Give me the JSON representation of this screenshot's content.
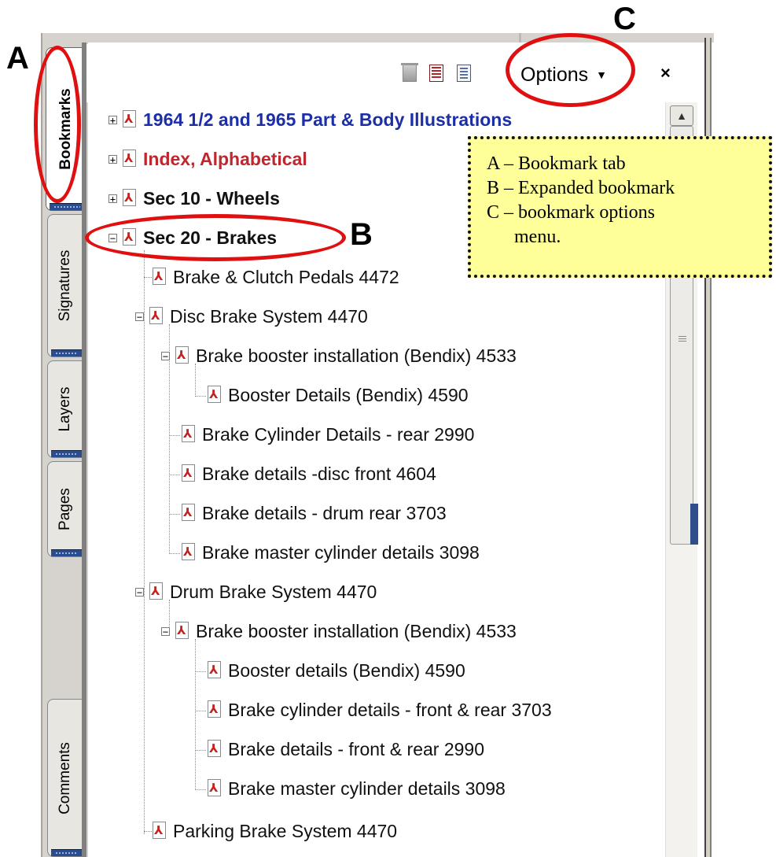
{
  "tabs": [
    {
      "label": "Bookmarks",
      "active": true
    },
    {
      "label": "Signatures",
      "active": false
    },
    {
      "label": "Layers",
      "active": false
    },
    {
      "label": "Pages",
      "active": false
    },
    {
      "label": "Comments",
      "active": false
    }
  ],
  "toolbar": {
    "delete_icon": "trash-icon",
    "new_bookmark_icon": "new-bookmark-icon",
    "expand_icon": "expand-bookmark-icon",
    "options_label": "Options",
    "close_glyph": "×"
  },
  "tree": [
    {
      "label": "1964 1/2 and 1965 Part & Body Illustrations",
      "style": "blue",
      "toggle": "+"
    },
    {
      "label": "Index, Alphabetical",
      "style": "red",
      "toggle": "+"
    },
    {
      "label": "Sec 10 - Wheels",
      "style": "bold",
      "toggle": "+"
    },
    {
      "label": "Sec 20 - Brakes",
      "style": "bold",
      "toggle": "−"
    },
    {
      "label": "Brake & Clutch Pedals 4472",
      "style": "normal"
    },
    {
      "label": "Disc Brake System 4470",
      "style": "normal",
      "toggle": "−"
    },
    {
      "label": "Brake booster installation (Bendix) 4533",
      "style": "normal",
      "toggle": "−"
    },
    {
      "label": "Booster Details (Bendix) 4590",
      "style": "normal"
    },
    {
      "label": "Brake Cylinder Details - rear 2990",
      "style": "normal"
    },
    {
      "label": "Brake details -disc front 4604",
      "style": "normal"
    },
    {
      "label": "Brake details - drum rear 3703",
      "style": "normal"
    },
    {
      "label": "Brake master cylinder details 3098",
      "style": "normal"
    },
    {
      "label": "Drum Brake System 4470",
      "style": "normal",
      "toggle": "−"
    },
    {
      "label": "Brake booster installation (Bendix) 4533",
      "style": "normal",
      "toggle": "−"
    },
    {
      "label": "Booster details (Bendix) 4590",
      "style": "normal"
    },
    {
      "label": "Brake cylinder details - front & rear 3703",
      "style": "normal"
    },
    {
      "label": "Brake details - front & rear 2990",
      "style": "normal"
    },
    {
      "label": "Brake master cylinder details 3098",
      "style": "normal"
    },
    {
      "label": "Parking Brake System 4470",
      "style": "normal"
    }
  ],
  "callout": {
    "line1": "A – Bookmark tab",
    "line2": "B – Expanded bookmark",
    "line3": "C – bookmark options",
    "line4": "menu."
  },
  "annotations": {
    "a": "A",
    "b": "B",
    "c": "C"
  },
  "colors": {
    "highlight_red": "#e01010",
    "callout_bg": "#ffff99",
    "blue_bookmark": "#1c2fa6",
    "red_bookmark": "#c0262d"
  }
}
